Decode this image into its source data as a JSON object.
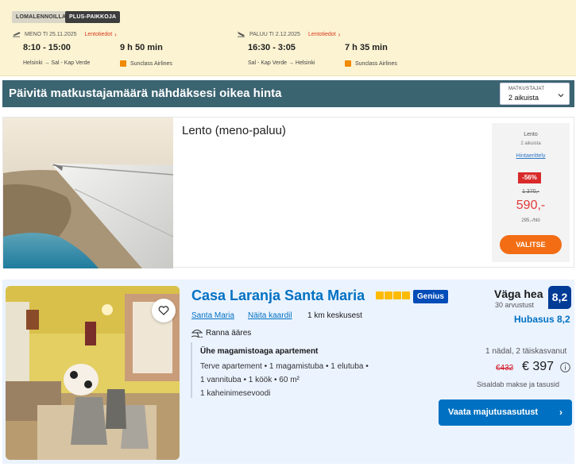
{
  "flight_strip": {
    "badges": [
      "LOMALENNOILLA",
      "PLUS-PAIKKOJA"
    ],
    "outbound": {
      "label": "MENO TI 25.11.2025",
      "info_link": "Lentotiedot",
      "time": "8:10 - 15:00",
      "duration": "9 h 50 min",
      "route": "Helsinki → Sal - Kap Verde",
      "airline": "Sunclass Airlines"
    },
    "return": {
      "label": "PALUU TI 2.12.2025",
      "info_link": "Lentotiedot",
      "time": "16:30 - 3:05",
      "duration": "7 h 35 min",
      "route": "Sal - Kap Verde → Helsinki",
      "airline": "Sunclass Airlines"
    }
  },
  "banner": {
    "text": "Päivitä matkustajamäärä nähdäksesi oikea hinta",
    "travellers_label": "MATKUSTAJAT",
    "travellers_value": "2 aikuista"
  },
  "flight_card": {
    "title": "Lento (meno-paluu)",
    "price_box": {
      "label": "Lento",
      "sub": "2 aikuista",
      "breakdown_link": "Hintaerittely",
      "discount": "-56%",
      "old_price": "1 370,-",
      "new_price": "590,-",
      "per_person": "295,-/hlö",
      "select_label": "VALITSE"
    }
  },
  "hotel_card": {
    "name": "Casa Laranja Santa Maria",
    "stars": 4,
    "genius_label": "Genius",
    "location_city": "Santa Maria",
    "map_link": "Näita kaardil",
    "distance": "1 km keskusest",
    "beach": "Ranna ääres",
    "room_title": "Ühe magamistoaga apartement",
    "room_lines": [
      "Terve apartement • 1 magamistuba • 1 elutuba •",
      "1 vannituba • 1 köök • 60 m²",
      "1 kaheinimesevoodi"
    ],
    "rating_word": "Väga hea",
    "rating_count": "30 arvustust",
    "rating_score": "8,2",
    "location_score": "Hubasus 8,2",
    "stay_info": "1 nädal, 2 täiskasvanut",
    "price_old": "€432",
    "price_new": "€ 397",
    "taxes_note": "Sisaldab makse ja tasusid",
    "cta_label": "Vaata majutusasutust",
    "cta_arrow": "›"
  },
  "colors": {
    "strip_bg": "#fbf3d2",
    "banner_bg": "#3b6471",
    "accent_orange": "#f26d14",
    "discount_red": "#d82a2a",
    "hotel_bg": "#ebf3ff",
    "brand_blue": "#0071c2",
    "score_blue": "#003b95"
  }
}
